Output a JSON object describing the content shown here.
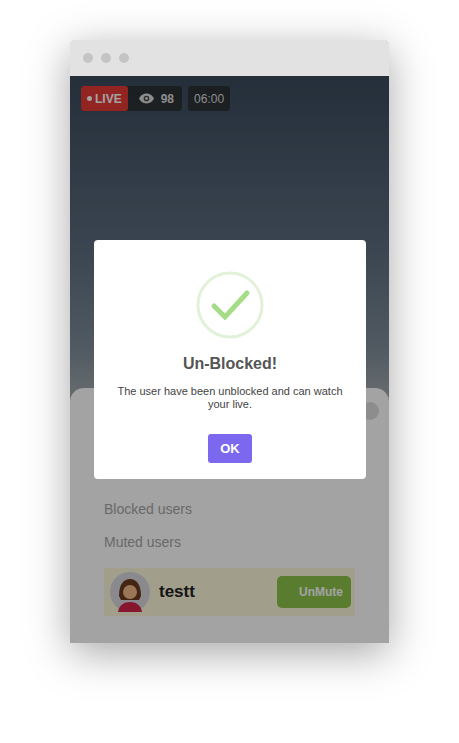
{
  "stream": {
    "live": "LIVE",
    "viewers": "98",
    "time": "06:00"
  },
  "sheet": {
    "items": [
      "Blocked users",
      "Muted users"
    ],
    "muted_users": [
      {
        "name": "testt",
        "action": "UnMute"
      }
    ]
  },
  "dialog": {
    "title": "Un-Blocked!",
    "message": "The user have been unblocked and can watch your live.",
    "button": "OK"
  }
}
